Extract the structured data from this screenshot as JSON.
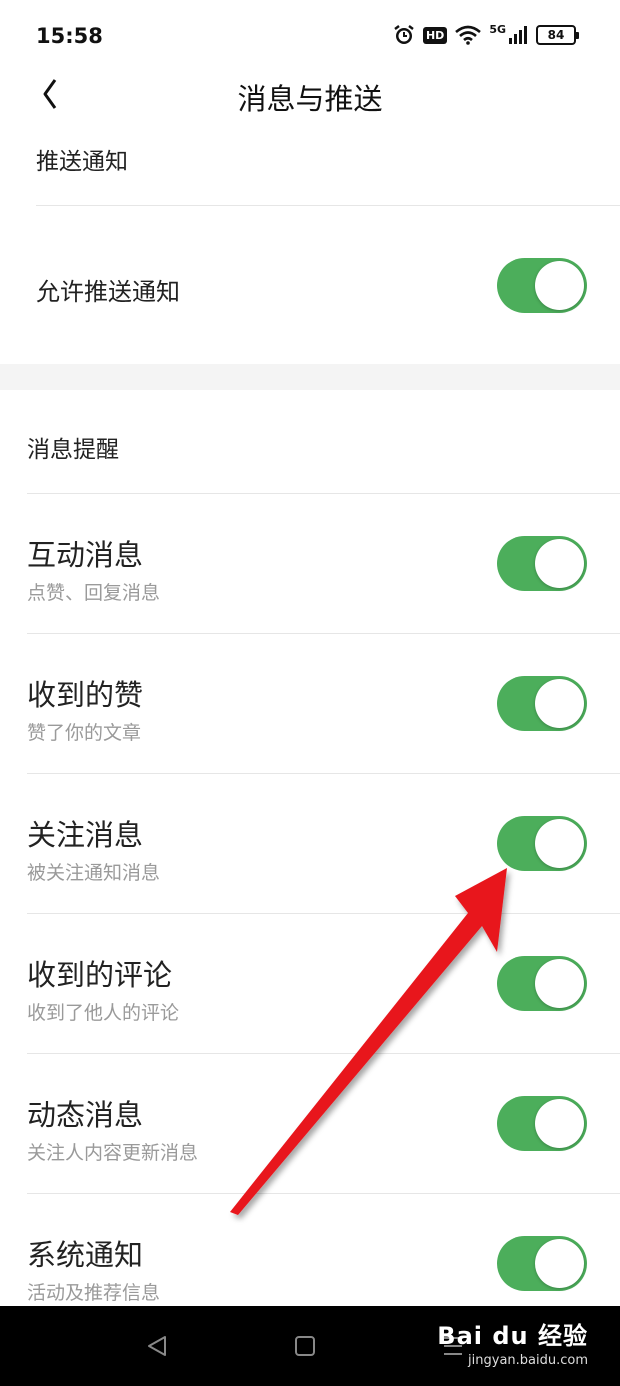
{
  "status_bar": {
    "time": "15:58",
    "net_label": "5G",
    "battery": "84",
    "icons": [
      "alarm-icon",
      "hd-badge",
      "wifi-icon",
      "signal-icon",
      "battery-icon"
    ]
  },
  "header": {
    "title": "消息与推送",
    "back_icon": "back-chevron-icon"
  },
  "push_section": {
    "heading": "推送通知",
    "allow_label": "允许推送通知",
    "allow_on": true
  },
  "reminder_section": {
    "heading": "消息提醒",
    "items": [
      {
        "title": "互动消息",
        "subtitle": "点赞、回复消息",
        "on": true
      },
      {
        "title": "收到的赞",
        "subtitle": "赞了你的文章",
        "on": true
      },
      {
        "title": "关注消息",
        "subtitle": "被关注通知消息",
        "on": true
      },
      {
        "title": "收到的评论",
        "subtitle": "收到了他人的评论",
        "on": true
      },
      {
        "title": "动态消息",
        "subtitle": "关注人内容更新消息",
        "on": true
      },
      {
        "title": "系统通知",
        "subtitle": "活动及推荐信息",
        "on": true
      }
    ]
  },
  "bottom_nav": {
    "icons": [
      "back-triangle-icon",
      "home-square-icon",
      "menu-lines-icon"
    ]
  },
  "watermark": {
    "main": "Bai du 经验",
    "sub": "jingyan.baidu.com"
  },
  "colors": {
    "toggle_on": "#4cae5b",
    "arrow": "#e8141c"
  }
}
